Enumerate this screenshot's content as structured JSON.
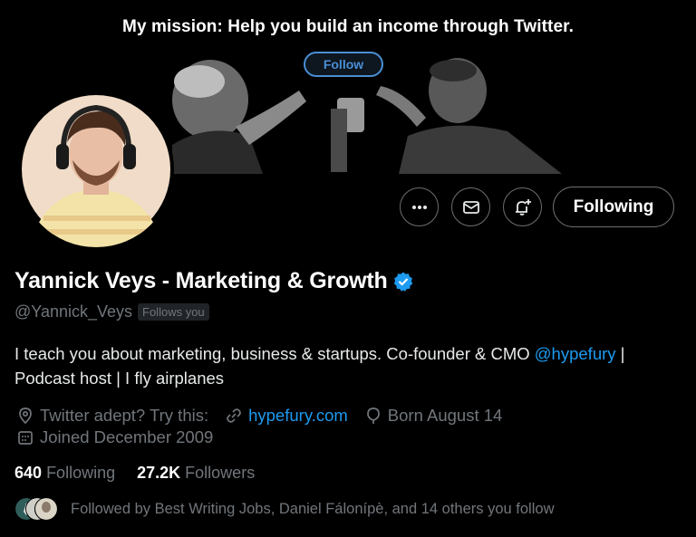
{
  "banner": {
    "mission": "My mission:  Help you build an income through Twitter.",
    "follow_label": "Follow"
  },
  "profile": {
    "display_name": "Yannick Veys - Marketing & Growth",
    "handle": "@Yannick_Veys",
    "follows_you": "Follows you",
    "bio_text": "I teach you about marketing, business & startups. Co-founder & CMO ",
    "bio_mention": "@hypefury",
    "bio_after": " |",
    "bio_line2": "Podcast host | I fly airplanes",
    "location": "Twitter adept? Try this:",
    "website": "hypefury.com",
    "birthday": "Born August 14",
    "joined": "Joined December 2009"
  },
  "actions": {
    "following_label": "Following",
    "more_icon": "more-dots-icon",
    "message_icon": "envelope-icon",
    "notify_icon": "bell-plus-icon"
  },
  "stats": {
    "following_count": "640",
    "following_label": "Following",
    "followers_count": "27.2K",
    "followers_label": "Followers"
  },
  "followed_by": {
    "text": "Followed by Best Writing Jobs, Daniel Fálonípè, and 14 others you follow"
  },
  "colors": {
    "accent": "#1d9bf0",
    "muted": "#71767b",
    "background": "#000000"
  }
}
